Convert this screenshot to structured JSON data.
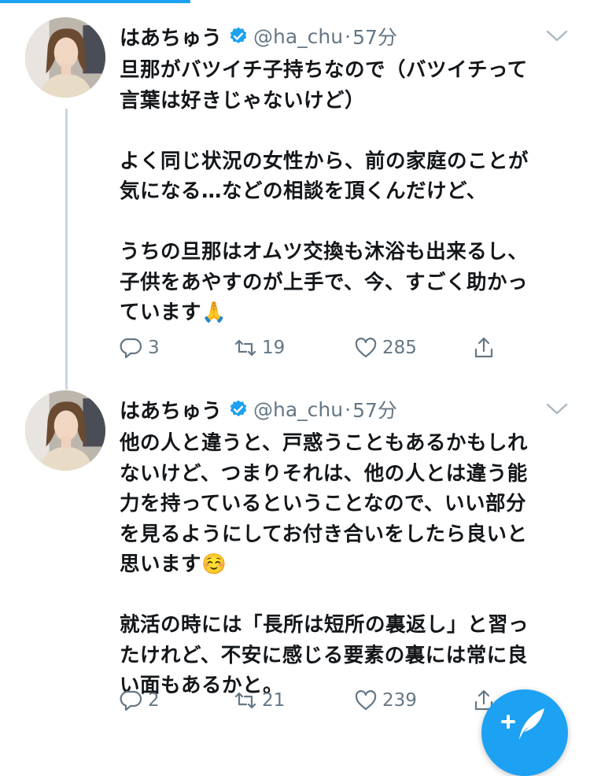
{
  "thread": [
    {
      "author": {
        "display_name": "はあちゅう",
        "handle": "@ha_chu",
        "separator": "·",
        "time": "57分"
      },
      "paragraphs": [
        [
          "旦那がバツイチ子持ちなので（バツイチって",
          "言葉は好きじゃないけど）"
        ],
        [
          "よく同じ状況の女性から、前の家庭のことが",
          "気になる…などの相談を頂くんだけど、"
        ],
        [
          "うちの旦那はオムツ交換も沐浴も出来るし、",
          "子供をあやすのが上手で、今、すごく助かっ",
          "ています🙏"
        ]
      ],
      "stats": {
        "replies": "3",
        "retweets": "19",
        "likes": "285"
      }
    },
    {
      "author": {
        "display_name": "はあちゅう",
        "handle": "@ha_chu",
        "separator": "·",
        "time": "57分"
      },
      "paragraphs": [
        [
          "他の人と違うと、戸惑うこともあるかもしれ",
          "ないけど、つまりそれは、他の人とは違う能",
          "力を持っているということなので、いい部分",
          "を見るようにしてお付き合いをしたら良いと",
          "思います☺️"
        ],
        [
          "就活の時には「長所は短所の裏返し」と習っ",
          "たけれど、不安に感じる要素の裏には常に良",
          "い面もあるかと。"
        ]
      ],
      "stats": {
        "replies": "2",
        "retweets": "21",
        "likes": "239"
      }
    }
  ],
  "icons": {
    "verified": "verified-badge-icon",
    "more": "chevron-down-icon",
    "reply": "reply-icon",
    "retweet": "retweet-icon",
    "like": "heart-icon",
    "share": "share-icon",
    "compose": "compose-tweet-icon"
  },
  "colors": {
    "accent": "#1da1f2",
    "text": "#14171a",
    "secondary": "#657786",
    "thread_line": "#ccd6dd"
  }
}
